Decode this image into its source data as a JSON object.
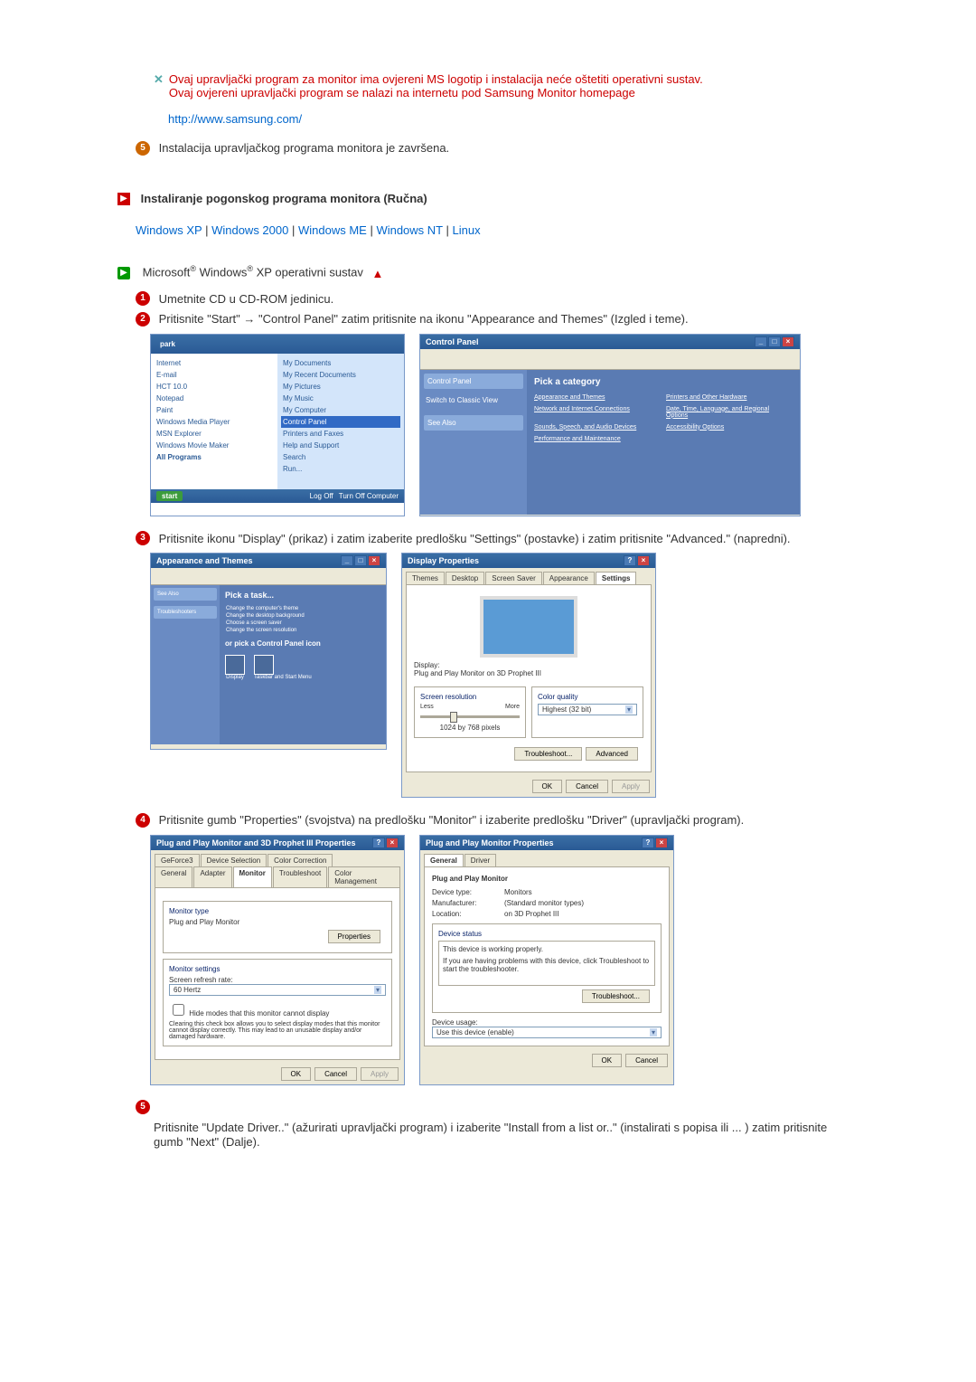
{
  "note": {
    "line1": "Ovaj upravljački program za monitor ima ovjereni MS logotip i instalacija neće oštetiti operativni sustav.",
    "line2": "Ovaj ovjereni upravljački program se nalazi na internetu pod Samsung Monitor homepage",
    "link": "http://www.samsung.com/"
  },
  "step5_top": "Instalacija upravljačkog programa monitora je završena.",
  "section_title": "Instaliranje pogonskog programa monitora (Ručna)",
  "os_links": [
    "Windows XP",
    "Windows 2000",
    "Windows ME",
    "Windows NT",
    "Linux"
  ],
  "os_row": {
    "prefix": "Microsoft",
    "middle": " Windows",
    "suffix": " XP operativni sustav"
  },
  "steps": {
    "s1": "Umetnite CD u CD-ROM jedinicu.",
    "s2": "Pritisnite \"Start\" → \"Control Panel\" zatim pritisnite na ikonu \"Appearance and Themes\" (Izgled i teme).",
    "s3": "Pritisnite ikonu \"Display\" (prikaz) i zatim izaberite predlošku \"Settings\" (postavke) i zatim pritisnite \"Advanced.\" (napredni).",
    "s4": "Pritisnite gumb \"Properties\" (svojstva) na predlošku \"Monitor\" i izaberite predlošku \"Driver\" (upravljački program).",
    "s5b": "Pritisnite \"Update Driver..\" (ažurirati upravljački program) i izaberite \"Install from a list or..\" (instalirati s popisa ili ... ) zatim pritisnite gumb \"Next\" (Dalje)."
  },
  "startmenu": {
    "header": "park",
    "left": [
      "Internet",
      "E-mail",
      "HCT 10.0",
      "Notepad",
      "Paint",
      "Windows Media Player",
      "MSN Explorer",
      "Windows Movie Maker",
      "All Programs"
    ],
    "right": [
      "My Documents",
      "My Recent Documents",
      "My Pictures",
      "My Music",
      "My Computer",
      "Control Panel",
      "Printers and Faxes",
      "Help and Support",
      "Search",
      "Run..."
    ],
    "taskbar": {
      "start": "start",
      "btn1": "Log Off",
      "btn2": "Turn Off Computer"
    }
  },
  "cpanel1": {
    "title": "Control Panel",
    "cat": "Pick a category",
    "side": [
      "Control Panel",
      "Switch to Classic View",
      "See Also"
    ],
    "items": [
      "Appearance and Themes",
      "Printers and Other Hardware",
      "Network and Internet Connections",
      "Date, Time, Language, and Regional Options",
      "Sounds, Speech, and Audio Devices",
      "Accessibility Options",
      "Performance and Maintenance"
    ]
  },
  "appthemes": {
    "title": "Appearance and Themes",
    "task": "Pick a task...",
    "tasks": [
      "Change the computer's theme",
      "Change the desktop background",
      "Choose a screen saver",
      "Change the screen resolution"
    ],
    "or": "or pick a Control Panel icon",
    "icons": [
      "Display",
      "Taskbar and Start Menu"
    ]
  },
  "display_props": {
    "title": "Display Properties",
    "tabs": [
      "Themes",
      "Desktop",
      "Screen Saver",
      "Appearance",
      "Settings"
    ],
    "display_label": "Display:",
    "display_val": "Plug and Play Monitor on 3D Prophet III",
    "res_label": "Screen resolution",
    "less": "Less",
    "more": "More",
    "res_val": "1024 by 768 pixels",
    "quality_label": "Color quality",
    "quality_val": "Highest (32 bit)",
    "btn_trouble": "Troubleshoot...",
    "btn_adv": "Advanced",
    "btn_ok": "OK",
    "btn_cancel": "Cancel",
    "btn_apply": "Apply"
  },
  "pnp_props": {
    "title": "Plug and Play Monitor and 3D Prophet III Properties",
    "tabs1": [
      "GeForce3",
      "Device Selection",
      "Color Correction"
    ],
    "tabs2": [
      "General",
      "Adapter",
      "Monitor",
      "Troubleshoot",
      "Color Management"
    ],
    "mon_type": "Monitor type",
    "mon_val": "Plug and Play Monitor",
    "btn_props": "Properties",
    "mon_settings": "Monitor settings",
    "refresh_label": "Screen refresh rate:",
    "refresh_val": "60 Hertz",
    "hide_check": "Hide modes that this monitor cannot display",
    "hide_desc": "Clearing this check box allows you to select display modes that this monitor cannot display correctly. This may lead to an unusable display and/or damaged hardware.",
    "btn_ok": "OK",
    "btn_cancel": "Cancel",
    "btn_apply": "Apply"
  },
  "mon_props": {
    "title": "Plug and Play Monitor Properties",
    "tabs": [
      "General",
      "Driver"
    ],
    "header": "Plug and Play Monitor",
    "dt_label": "Device type:",
    "dt_val": "Monitors",
    "mf_label": "Manufacturer:",
    "mf_val": "(Standard monitor types)",
    "loc_label": "Location:",
    "loc_val": "on 3D Prophet III",
    "status_title": "Device status",
    "status_text": "This device is working properly.",
    "status_hint": "If you are having problems with this device, click Troubleshoot to start the troubleshooter.",
    "btn_trouble": "Troubleshoot...",
    "usage_label": "Device usage:",
    "usage_val": "Use this device (enable)",
    "btn_ok": "OK",
    "btn_cancel": "Cancel"
  }
}
